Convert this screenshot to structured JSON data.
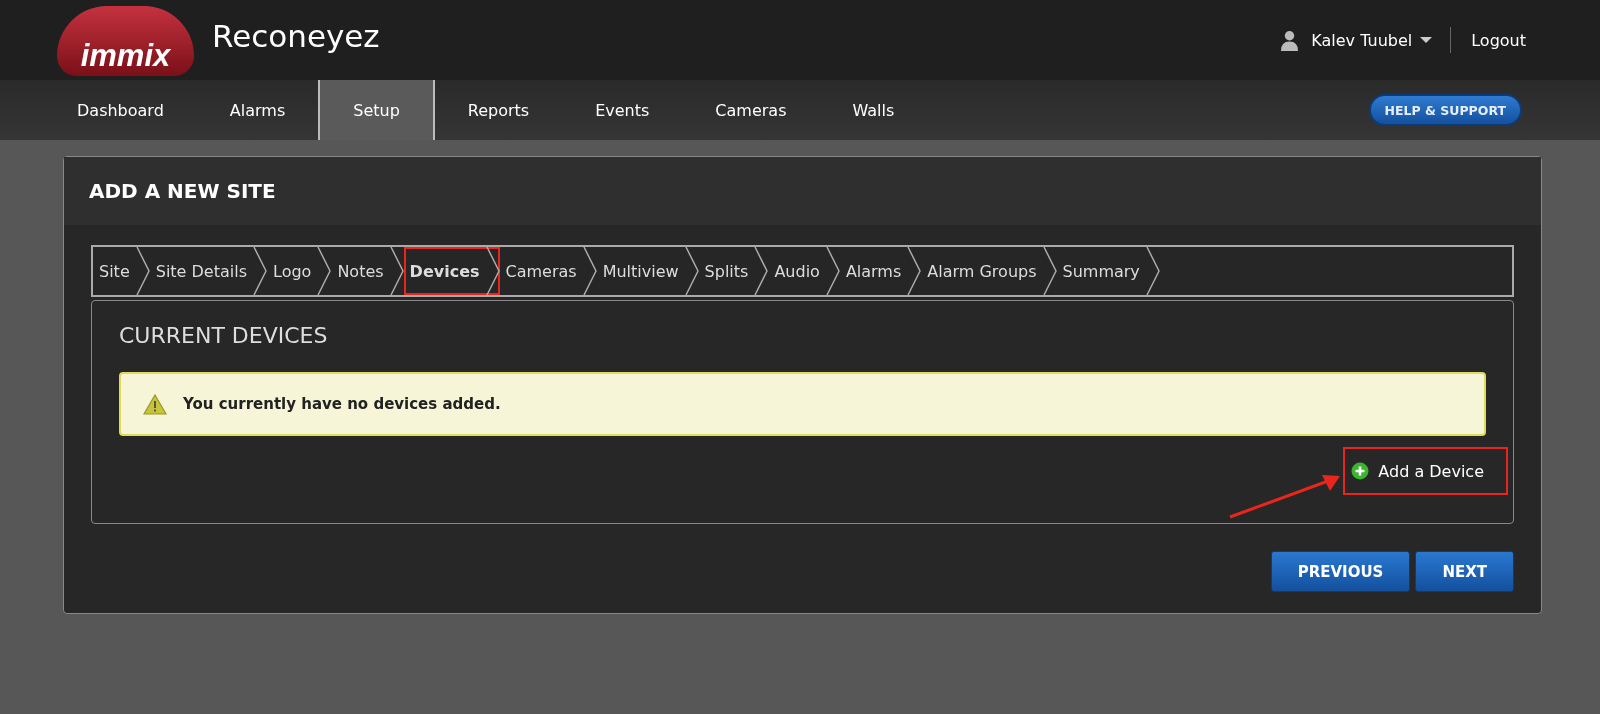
{
  "header": {
    "logo": "immix",
    "app_title": "Reconeyez",
    "user": "Kalev Tuubel",
    "logout": "Logout"
  },
  "nav": {
    "items": [
      {
        "label": "Dashboard",
        "selected": false
      },
      {
        "label": "Alarms",
        "selected": false
      },
      {
        "label": "Setup",
        "selected": true
      },
      {
        "label": "Reports",
        "selected": false
      },
      {
        "label": "Events",
        "selected": false
      },
      {
        "label": "Cameras",
        "selected": false
      },
      {
        "label": "Walls",
        "selected": false
      }
    ],
    "help_button": "HELP & SUPPORT"
  },
  "panel": {
    "title": "ADD A NEW SITE",
    "steps": [
      {
        "label": "Site",
        "selected": false,
        "highlighted": false
      },
      {
        "label": "Site Details",
        "selected": false,
        "highlighted": false
      },
      {
        "label": "Logo",
        "selected": false,
        "highlighted": false
      },
      {
        "label": "Notes",
        "selected": false,
        "highlighted": false
      },
      {
        "label": "Devices",
        "selected": true,
        "highlighted": true
      },
      {
        "label": "Cameras",
        "selected": false,
        "highlighted": false
      },
      {
        "label": "Multiview",
        "selected": false,
        "highlighted": false
      },
      {
        "label": "Splits",
        "selected": false,
        "highlighted": false
      },
      {
        "label": "Audio",
        "selected": false,
        "highlighted": false
      },
      {
        "label": "Alarms",
        "selected": false,
        "highlighted": false
      },
      {
        "label": "Alarm Groups",
        "selected": false,
        "highlighted": false
      },
      {
        "label": "Summary",
        "selected": false,
        "highlighted": false
      }
    ],
    "section_title": "CURRENT DEVICES",
    "alert": "You currently have no devices added.",
    "add_device": {
      "label": "Add a Device",
      "highlighted": true
    },
    "buttons": [
      "PREVIOUS",
      "NEXT"
    ]
  }
}
